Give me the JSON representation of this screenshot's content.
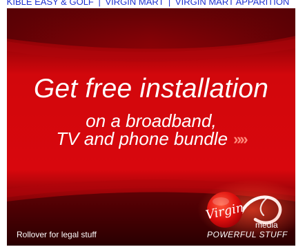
{
  "top_links": {
    "items": [
      {
        "label": "KIBLE EASY & GOLF"
      },
      {
        "label": "VIRGIN MART"
      },
      {
        "label": "VIRGIN MART APPARITION"
      }
    ],
    "separator": "|"
  },
  "ad": {
    "headline": "Get free installation",
    "subline_1": "on a broadband,",
    "subline_2": "TV and phone bundle",
    "arrow_glyph": "»»",
    "legal_link": "Rollover for legal stuff",
    "logo": {
      "wordmark": "Virgin",
      "submark": "media",
      "icon": "virgin-media-logo"
    },
    "tagline": "POWERFUL STUFF",
    "colors": {
      "brand_red": "#d8070d",
      "dark_red": "#4a0103",
      "link_blue": "#1b2fd1",
      "text": "#ffffff"
    }
  }
}
